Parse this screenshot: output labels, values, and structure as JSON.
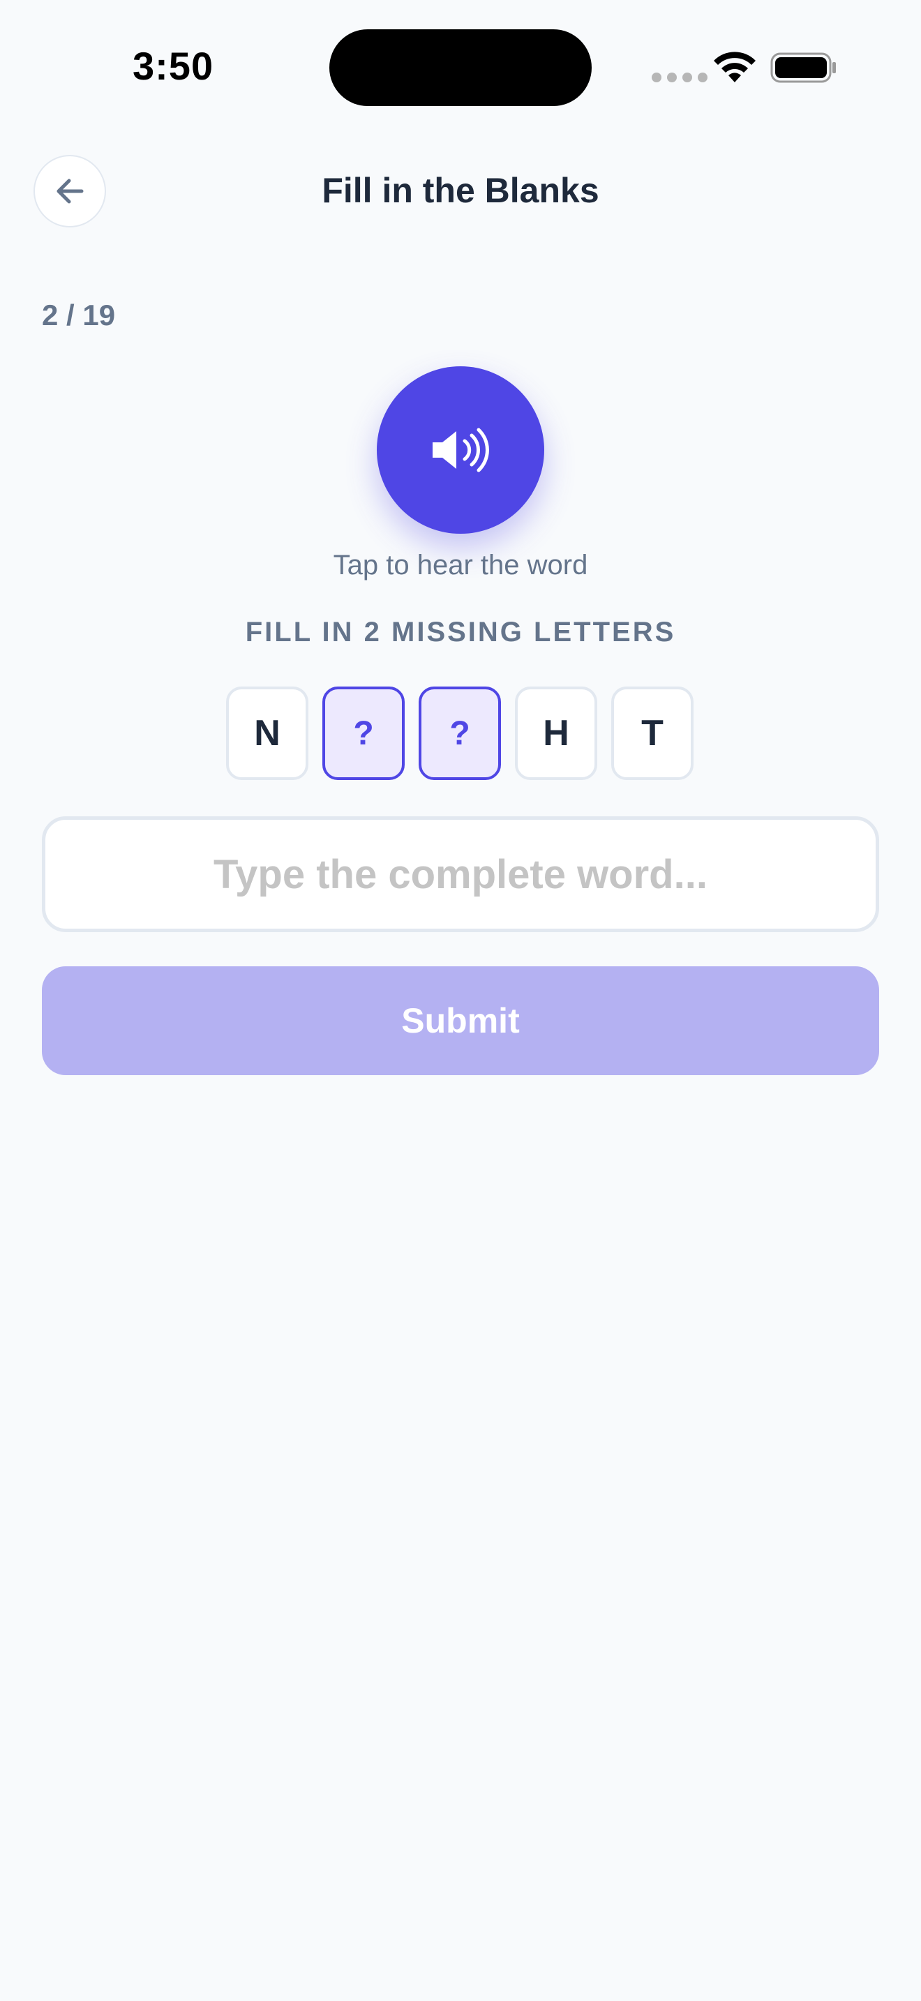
{
  "status_bar": {
    "time": "3:50"
  },
  "header": {
    "title": "Fill in the Blanks",
    "back_icon": "arrow-left-icon"
  },
  "progress": {
    "label": "2 / 19",
    "current": 2,
    "total": 19
  },
  "audio": {
    "icon": "speaker-icon",
    "hint": "Tap to hear the word"
  },
  "instruction": "FILL IN 2 MISSING LETTERS",
  "tiles": [
    {
      "letter": "N",
      "missing": false
    },
    {
      "letter": "?",
      "missing": true
    },
    {
      "letter": "?",
      "missing": true
    },
    {
      "letter": "H",
      "missing": false
    },
    {
      "letter": "T",
      "missing": false
    }
  ],
  "answer_input": {
    "value": "",
    "placeholder": "Type the complete word..."
  },
  "submit": {
    "label": "Submit",
    "enabled": false
  },
  "colors": {
    "accent": "#4f46e5",
    "accent_light": "#ede9fe",
    "submit_disabled": "#b4b1f2",
    "background": "#f8fafc",
    "text_primary": "#1e293b",
    "text_muted": "#64748b"
  }
}
